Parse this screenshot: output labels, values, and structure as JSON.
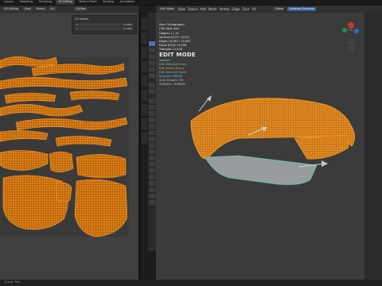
{
  "app": {
    "name": "Blender"
  },
  "top_tabs": [
    "Layout",
    "Modeling",
    "Sculpting",
    "UV Editing",
    "Texture Paint",
    "Shading",
    "Animation"
  ],
  "uv_editor": {
    "header": {
      "mode_label": "UV Editing",
      "image_label": "UVMap",
      "view_label": "View",
      "select_label": "Select",
      "uv_label": "UV"
    },
    "n_panel": {
      "title": "UV Vertex",
      "rows": [
        {
          "label": "X",
          "value": "0.1161"
        },
        {
          "label": "Y",
          "value": "0.1931"
        }
      ]
    }
  },
  "viewport": {
    "header": {
      "mode": "Edit Mode",
      "menus": [
        "View",
        "Select",
        "Add",
        "Mesh",
        "Vertex",
        "Edge",
        "Face",
        "UV"
      ],
      "orientation": "Global",
      "selected_label": "Selected Overlays"
    },
    "overlay": {
      "projection": "User Orthographic",
      "object": "(16) light_lens",
      "stats": [
        {
          "label": "Objects",
          "value": "1 / 10"
        },
        {
          "label": "Vertices",
          "value": "8,071 / 8,071"
        },
        {
          "label": "Edges",
          "value": "15,987 / 15,987"
        },
        {
          "label": "Faces",
          "value": "8,052 / 8,058"
        },
        {
          "label": "Triangles",
          "value": "12,016"
        }
      ],
      "mode_title": "EDIT MODE",
      "legend_head": "Inactive",
      "legend_items": [
        "Edit Selected Items",
        "Edit Seams Sharp",
        "Edit Selected Faces"
      ],
      "bottom_lines": [
        "Normals: MERGE",
        "Auto Smooth: ON",
        "Statistics: NORMAL"
      ]
    }
  },
  "status_bar": {
    "text": "Cursor Pick"
  },
  "colors": {
    "accent": "#e88a1a",
    "selection": "#f0a030",
    "lens": "#9a9ea0",
    "edge": "#5fd1a8"
  }
}
